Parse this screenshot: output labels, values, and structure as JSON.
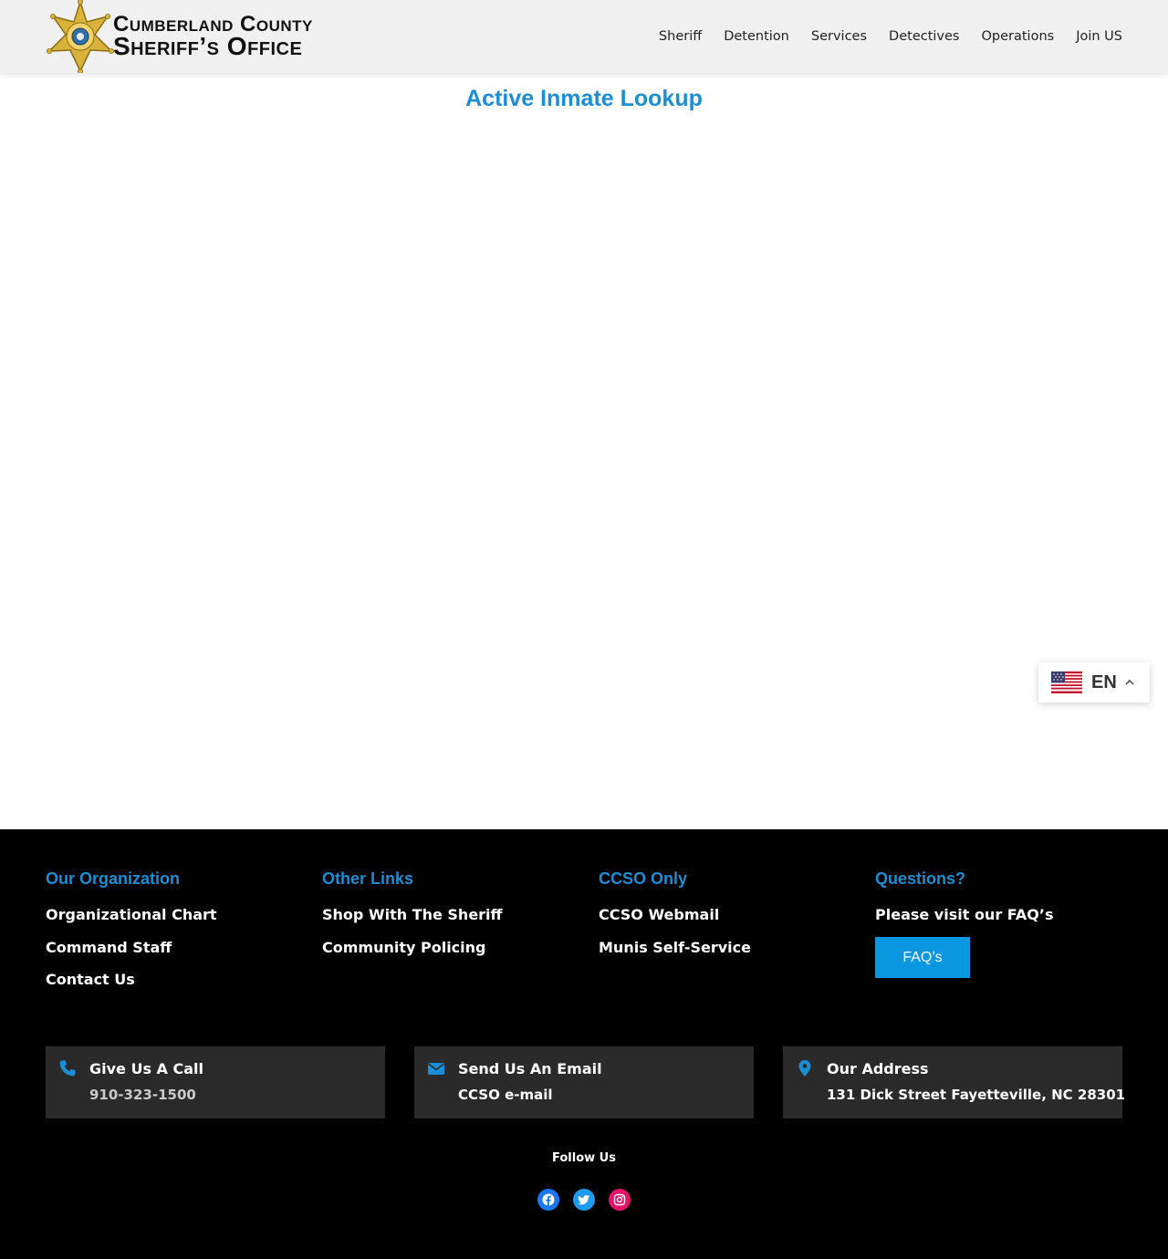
{
  "header": {
    "logo": {
      "line1": "Cumberland County",
      "line2": "Sheriff’s Office",
      "badge_color": "#d9b23a"
    },
    "nav": [
      {
        "label": "Sheriff"
      },
      {
        "label": "Detention"
      },
      {
        "label": "Services"
      },
      {
        "label": "Detectives"
      },
      {
        "label": "Operations"
      },
      {
        "label": "Join US"
      }
    ]
  },
  "main": {
    "title": "Active Inmate Lookup"
  },
  "language": {
    "code": "EN",
    "flag_icon": "us-flag-icon",
    "expand_icon": "chevron-up-icon"
  },
  "footer": {
    "columns": [
      {
        "heading": "Our Organization",
        "links": [
          "Organizational Chart",
          "Command Staff",
          "Contact Us"
        ]
      },
      {
        "heading": "Other Links",
        "links": [
          "Shop With The Sheriff",
          "Community Policing"
        ]
      },
      {
        "heading": "CCSO Only",
        "links": [
          "CCSO Webmail",
          "Munis Self-Service"
        ]
      },
      {
        "heading": "Questions?",
        "text": "Please visit our FAQ’s",
        "button_label": "FAQ’s"
      }
    ],
    "contacts": [
      {
        "icon": "phone-icon",
        "title": "Give Us A Call",
        "value": "910-323-1500"
      },
      {
        "icon": "envelope-icon",
        "title": "Send Us An Email",
        "value": "CCSO e-mail"
      },
      {
        "icon": "map-pin-icon",
        "title": "Our Address",
        "value": "131 Dick Street Fayetteville, NC 28301"
      }
    ],
    "follow_label": "Follow Us",
    "socials": [
      {
        "icon": "facebook-icon",
        "color": "#1877f2"
      },
      {
        "icon": "twitter-icon",
        "color": "#1d9bf0"
      },
      {
        "icon": "instagram-icon",
        "color": "#e4126b"
      }
    ],
    "accent_color": "#1a8fd6",
    "button_color": "#0b96e0"
  }
}
